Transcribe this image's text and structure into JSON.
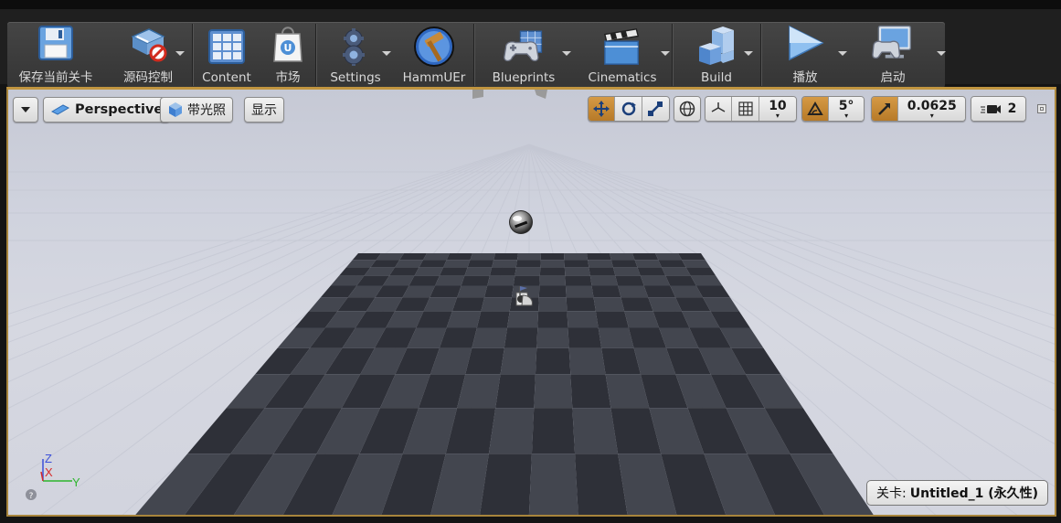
{
  "toolbar": {
    "items": [
      {
        "id": "save",
        "label": "保存当前关卡",
        "icon": "floppy-disk-icon",
        "dropdown": false
      },
      {
        "id": "source-control",
        "label": "源码控制",
        "icon": "source-control-icon",
        "dropdown": true
      },
      {
        "id": "content",
        "label": "Content",
        "icon": "content-browser-icon",
        "dropdown": false
      },
      {
        "id": "marketplace",
        "label": "市场",
        "icon": "marketplace-bag-icon",
        "dropdown": false
      },
      {
        "id": "settings",
        "label": "Settings",
        "icon": "gears-icon",
        "dropdown": true
      },
      {
        "id": "hammuer",
        "label": "HammUEr",
        "icon": "hammer-icon",
        "dropdown": false
      },
      {
        "id": "blueprints",
        "label": "Blueprints",
        "icon": "gamepad-blueprint-icon",
        "dropdown": true
      },
      {
        "id": "cinematics",
        "label": "Cinematics",
        "icon": "clapperboard-icon",
        "dropdown": true
      },
      {
        "id": "build",
        "label": "Build",
        "icon": "build-cubes-icon",
        "dropdown": true
      },
      {
        "id": "play",
        "label": "播放",
        "icon": "play-icon",
        "dropdown": true
      },
      {
        "id": "launch",
        "label": "启动",
        "icon": "launch-monitor-icon",
        "dropdown": true
      }
    ]
  },
  "viewport": {
    "view_mode": "Perspective",
    "lighting_mode": "带光照",
    "show_label": "显示",
    "grid_snap_value": "10",
    "rotation_snap_value": "5°",
    "scale_snap_value": "0.0625",
    "camera_speed": "2",
    "level_prefix": "关卡:",
    "level_name": "Untitled_1 (永久性)",
    "axis": {
      "z": "Z",
      "x": "X",
      "y": "Y"
    }
  },
  "colors": {
    "accent_orange": "#c88a34",
    "viewport_bg": "#d0d3de",
    "floor_dark": "#2e3038",
    "floor_light": "#43464f"
  }
}
